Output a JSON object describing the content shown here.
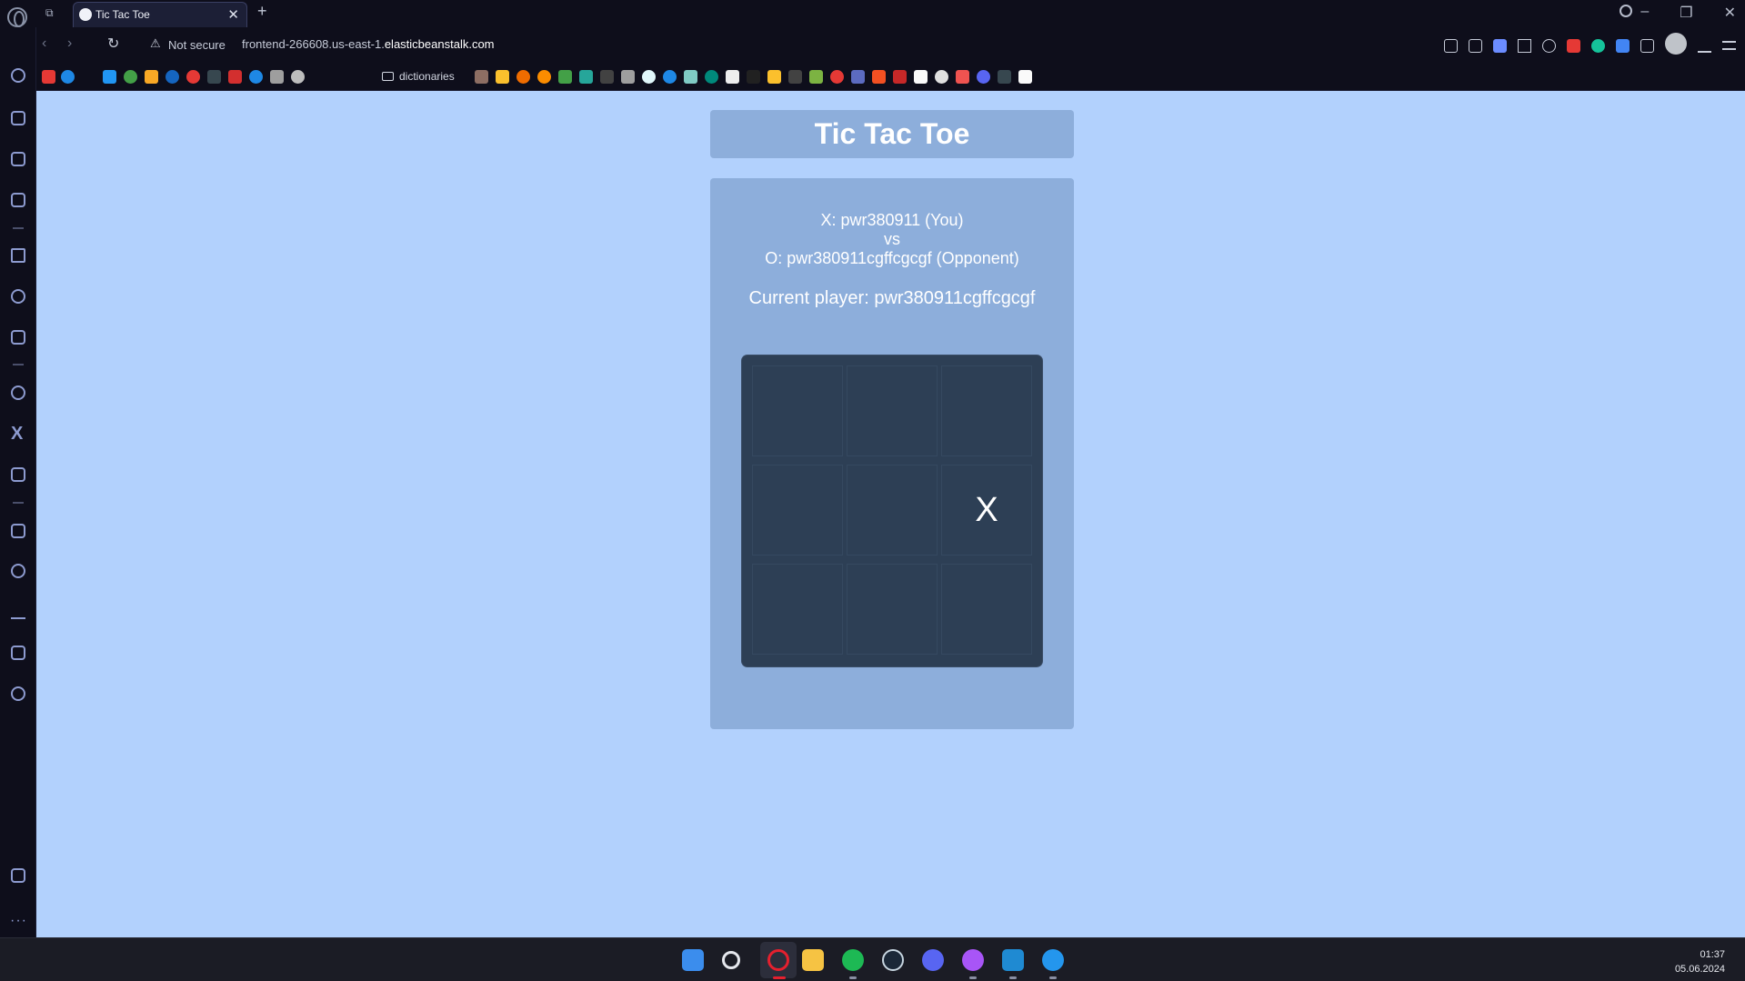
{
  "browser": {
    "tab_title": "Tic Tac Toe",
    "security_label": "Not secure",
    "url_prefix": "frontend-266608.us-east-1.",
    "url_domain": "elasticbeanstalk.com",
    "bookmark_folder": "dictionaries"
  },
  "page": {
    "title": "Tic Tac Toe",
    "player_x": "X: pwr380911 (You)",
    "vs": "vs",
    "player_o": "O: pwr380911cgffcgcgf (Opponent)",
    "current_player": "Current player: pwr380911cgffcgcgf"
  },
  "board": [
    "",
    "",
    "",
    "",
    "",
    "X",
    "",
    "",
    ""
  ],
  "taskbar": {
    "time": "01:37",
    "date": "05.06.2024"
  },
  "colors": {
    "page_bg": "#b2d1fd",
    "panel_bg": "#8daedb",
    "board_bg": "#2d3f55"
  }
}
